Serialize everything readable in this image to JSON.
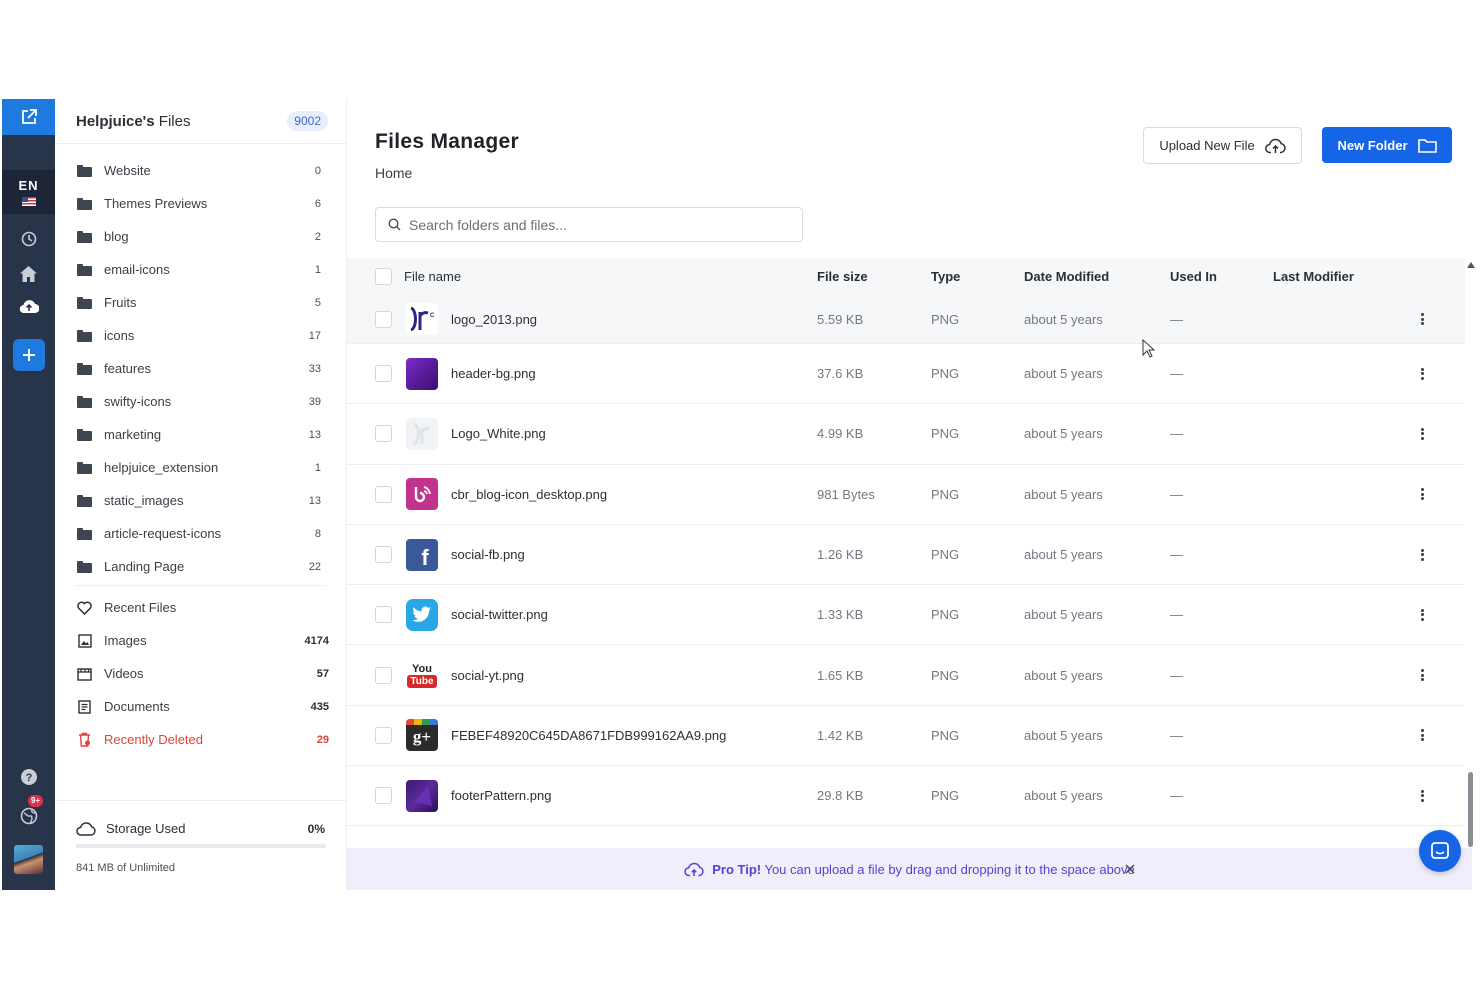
{
  "colors": {
    "rail": "#28344a",
    "primary": "#1565e6",
    "danger": "#e0443a",
    "tip_text": "#5b3fcf"
  },
  "rail": {
    "language": "EN",
    "notification_badge": "9+",
    "icons": [
      "external-link-icon",
      "history-icon",
      "home-icon",
      "cloud-upload-icon",
      "plus-icon",
      "help-icon",
      "globe-icon",
      "avatar"
    ]
  },
  "sidebar": {
    "title_bold": "Helpjuice's",
    "title_rest": " Files",
    "total_count": "9002",
    "folders": [
      {
        "label": "Website",
        "count": "0"
      },
      {
        "label": "Themes Previews",
        "count": "6"
      },
      {
        "label": "blog",
        "count": "2"
      },
      {
        "label": "email-icons",
        "count": "1"
      },
      {
        "label": "Fruits",
        "count": "5"
      },
      {
        "label": "icons",
        "count": "17"
      },
      {
        "label": "features",
        "count": "33"
      },
      {
        "label": "swifty-icons",
        "count": "39"
      },
      {
        "label": "marketing",
        "count": "13"
      },
      {
        "label": "helpjuice_extension",
        "count": "1"
      },
      {
        "label": "static_images",
        "count": "13"
      },
      {
        "label": "article-request-icons",
        "count": "8"
      },
      {
        "label": "Landing Page",
        "count": "22"
      }
    ],
    "library": [
      {
        "label": "Recent Files",
        "count": "",
        "icon": "heart-icon"
      },
      {
        "label": "Images",
        "count": "4174",
        "icon": "image-icon"
      },
      {
        "label": "Videos",
        "count": "57",
        "icon": "video-icon"
      },
      {
        "label": "Documents",
        "count": "435",
        "icon": "document-icon"
      },
      {
        "label": "Recently Deleted",
        "count": "29",
        "icon": "trash-icon"
      }
    ],
    "storage": {
      "label": "Storage Used",
      "percent": "0%",
      "usage_fraction": 0,
      "note": "841 MB of Unlimited"
    }
  },
  "main": {
    "title": "Files Manager",
    "breadcrumb": "Home",
    "upload_label": "Upload New File",
    "new_folder_label": "New Folder",
    "search_placeholder": "Search folders and files...",
    "columns": {
      "name": "File name",
      "size": "File size",
      "type": "Type",
      "date": "Date Modified",
      "used": "Used In",
      "modifier": "Last Modifier"
    },
    "files": [
      {
        "name": "logo_2013.png",
        "size": "5.59 KB",
        "type": "PNG",
        "date": "about 5 years",
        "used": "—",
        "thumb": "logo-dark"
      },
      {
        "name": "header-bg.png",
        "size": "37.6 KB",
        "type": "PNG",
        "date": "about 5 years",
        "used": "—",
        "thumb": "purple"
      },
      {
        "name": "Logo_White.png",
        "size": "4.99 KB",
        "type": "PNG",
        "date": "about 5 years",
        "used": "—",
        "thumb": "logo-white"
      },
      {
        "name": "cbr_blog-icon_desktop.png",
        "size": "981 Bytes",
        "type": "PNG",
        "date": "about 5 years",
        "used": "—",
        "thumb": "blog"
      },
      {
        "name": "social-fb.png",
        "size": "1.26 KB",
        "type": "PNG",
        "date": "about 5 years",
        "used": "—",
        "thumb": "fb"
      },
      {
        "name": "social-twitter.png",
        "size": "1.33 KB",
        "type": "PNG",
        "date": "about 5 years",
        "used": "—",
        "thumb": "twitter"
      },
      {
        "name": "social-yt.png",
        "size": "1.65 KB",
        "type": "PNG",
        "date": "about 5 years",
        "used": "—",
        "thumb": "yt"
      },
      {
        "name": "FEBEF48920C645DA8671FDB999162AA9.png",
        "size": "1.42 KB",
        "type": "PNG",
        "date": "about 5 years",
        "used": "—",
        "thumb": "gplus"
      },
      {
        "name": "footerPattern.png",
        "size": "29.8 KB",
        "type": "PNG",
        "date": "about 5 years",
        "used": "—",
        "thumb": "pattern"
      }
    ],
    "tip": {
      "bold": "Pro Tip!",
      "text": " You can upload a file by drag and dropping it to the space above"
    }
  }
}
